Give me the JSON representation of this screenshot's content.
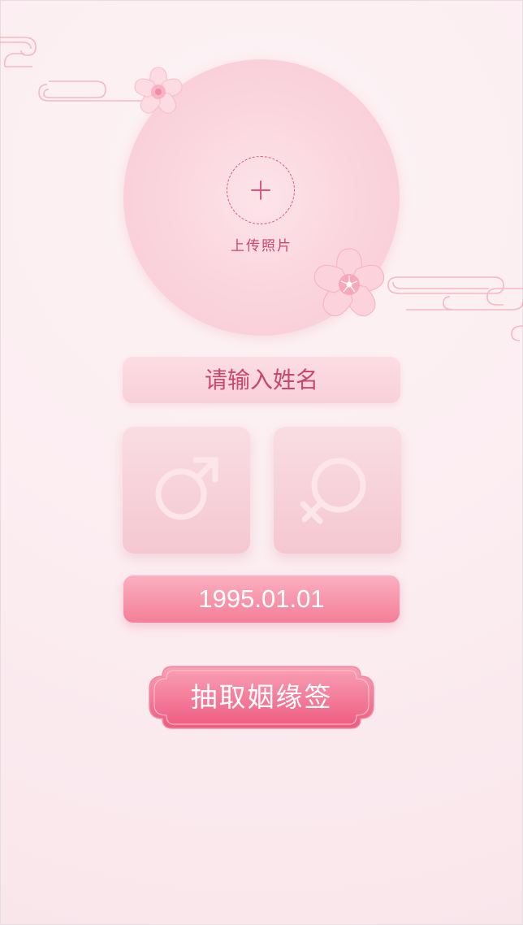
{
  "upload": {
    "label": "上传照片",
    "icon": "plus-icon"
  },
  "name_input": {
    "placeholder": "请输入姓名",
    "value": ""
  },
  "gender": {
    "male_icon": "male-symbol-icon",
    "female_icon": "female-symbol-icon"
  },
  "birthday": {
    "value": "1995.01.01"
  },
  "draw_button": {
    "label": "抽取姻缘签"
  },
  "colors": {
    "accent": "#c8476e",
    "background": "#fbeef1",
    "button_pink": "#f47e98"
  }
}
